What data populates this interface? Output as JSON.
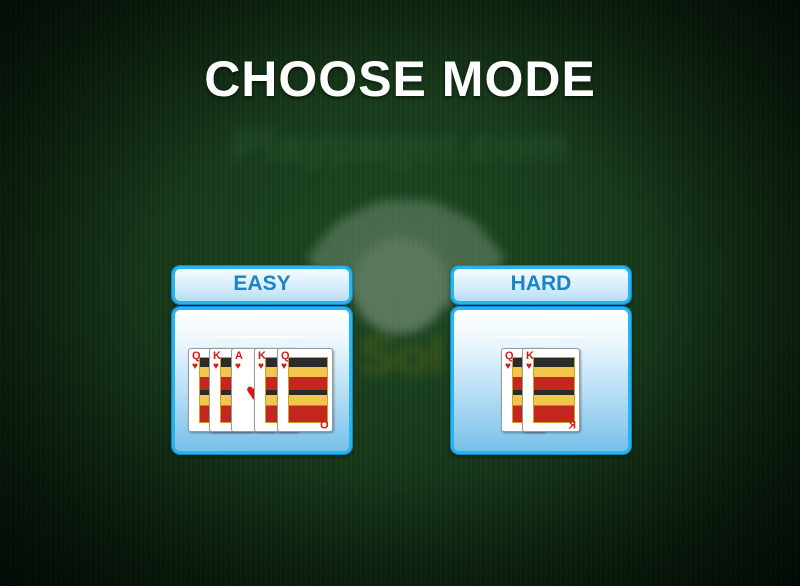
{
  "title": "CHOOSE MODE",
  "background": {
    "logo_text": "Playpager.com",
    "logo_partial_text": "Sol"
  },
  "modes": [
    {
      "label": "EASY",
      "cards": [
        {
          "rank": "Q",
          "suit": "♥",
          "face": true
        },
        {
          "rank": "K",
          "suit": "♥",
          "face": true
        },
        {
          "rank": "A",
          "suit": "♥",
          "face": false
        },
        {
          "rank": "K",
          "suit": "♥",
          "face": true
        },
        {
          "rank": "Q",
          "suit": "♥",
          "face": true
        }
      ]
    },
    {
      "label": "HARD",
      "cards": [
        {
          "rank": "Q",
          "suit": "♥",
          "face": true
        },
        {
          "rank": "K",
          "suit": "♥",
          "face": true
        }
      ]
    }
  ],
  "colors": {
    "accent": "#28b4ee",
    "label_text": "#1c83c6",
    "suit_red": "#d21a1a"
  }
}
